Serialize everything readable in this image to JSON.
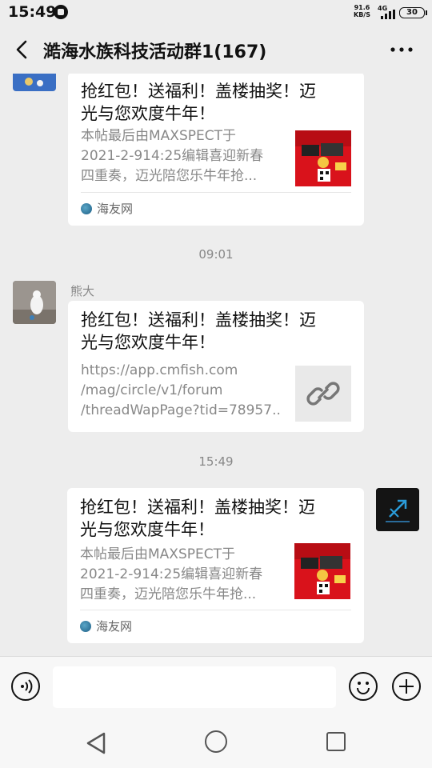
{
  "status_bar": {
    "time": "15:49",
    "net_speed_value": "91.6",
    "net_speed_unit": "KB/S",
    "network": "4G",
    "battery": "30"
  },
  "header": {
    "title": "澔海水族科技活动群1(167)"
  },
  "messages": [
    {
      "title_line1": "抢红包！送福利！盖楼抽奖！迈",
      "title_line2": "光与您欢度牛年！",
      "desc": [
        "本帖最后由MAXSPECT于",
        "2021-2-914:25编辑喜迎新春",
        "四重奏，迈光陪您乐牛年抢..."
      ],
      "source": "海友网"
    },
    {
      "timestamp": "09:01",
      "sender": "熊大",
      "title_line1": "抢红包！送福利！盖楼抽奖！迈",
      "title_line2": "光与您欢度牛年！",
      "desc": [
        "https://app.cmfish.com",
        "/mag/circle/v1/forum",
        "/threadWapPage?tid=78957..."
      ]
    },
    {
      "timestamp": "15:49",
      "title_line1": "抢红包！送福利！盖楼抽奖！迈",
      "title_line2": "光与您欢度牛年！",
      "desc": [
        "本帖最后由MAXSPECT于",
        "2021-2-914:25编辑喜迎新春",
        "四重奏，迈光陪您乐牛年抢..."
      ],
      "source": "海友网"
    }
  ],
  "input": {
    "placeholder": ""
  },
  "colors": {
    "background": "#ededed",
    "card": "#ffffff",
    "thumbnail_red": "#d9121b"
  },
  "icons": {
    "back": "chevron-left-icon",
    "more": "more-dots-icon",
    "voice": "voice-icon",
    "emoji": "emoji-icon",
    "plus": "plus-icon",
    "link": "link-icon"
  }
}
